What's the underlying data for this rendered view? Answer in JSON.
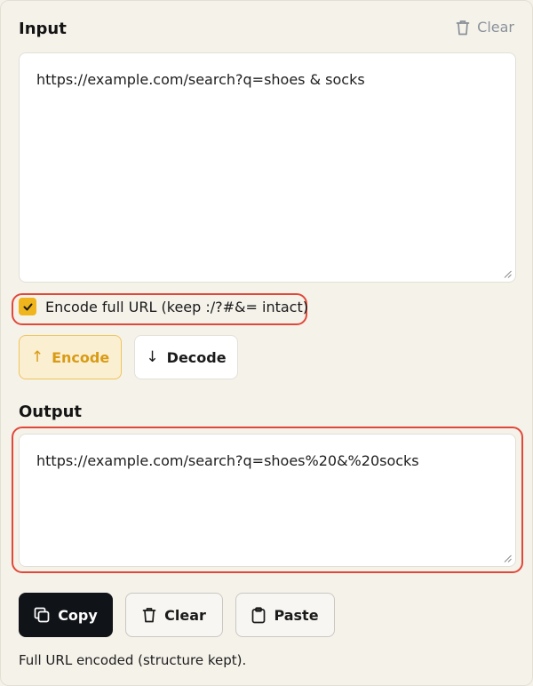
{
  "input": {
    "title": "Input",
    "clear_label": "Clear",
    "value": "https://example.com/search?q=shoes & socks"
  },
  "options": {
    "encode_full_url_label": "Encode full URL (keep :/?#&= intact)",
    "encode_full_url_checked": true
  },
  "actions": {
    "encode_label": "Encode",
    "encode_arrow": "↑",
    "decode_label": "Decode",
    "decode_arrow": "↓"
  },
  "output": {
    "title": "Output",
    "value": "https://example.com/search?q=shoes%20&%20socks",
    "copy_label": "Copy",
    "clear_label": "Clear",
    "paste_label": "Paste"
  },
  "status": {
    "message": "Full URL encoded (structure kept)."
  },
  "colors": {
    "accent": "#f0b51c",
    "highlight": "#e0493a",
    "primary_dark": "#101318"
  }
}
